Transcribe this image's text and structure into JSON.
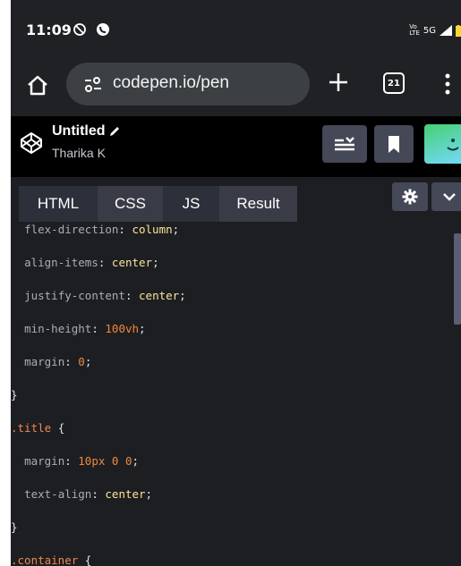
{
  "status_bar": {
    "time": "11:09",
    "network_top": "Vo",
    "network_bottom": "LTE",
    "signal_label": "5G"
  },
  "browser": {
    "url": "codepen.io/pen",
    "tab_count": "21"
  },
  "pen": {
    "title": "Untitled",
    "author": "Tharika K"
  },
  "editor_tabs": [
    {
      "label": "HTML"
    },
    {
      "label": "CSS"
    },
    {
      "label": "JS"
    },
    {
      "label": "Result"
    }
  ],
  "code_lines": [
    {
      "prop": "flex-direction",
      "value": "column"
    },
    {
      "prop": "align-items",
      "value": "center"
    },
    {
      "prop": "justify-content",
      "value": "center"
    },
    {
      "prop": "min-height",
      "value": "100vh"
    },
    {
      "prop": "margin",
      "value": "0"
    },
    {
      "brace": "}"
    },
    {
      "selector": ".title",
      "brace": "{"
    },
    {
      "prop": "margin",
      "value": "10px 0 0"
    },
    {
      "prop": "text-align",
      "value": "center"
    },
    {
      "brace": "}"
    },
    {
      "selector": ".container",
      "brace": "{"
    }
  ],
  "colors": {
    "status_bg": "#202124",
    "header_bg": "#000000",
    "editor_bg": "#1d1e22",
    "value_yellow": "#fbe39b",
    "value_orange": "#ef8839"
  }
}
